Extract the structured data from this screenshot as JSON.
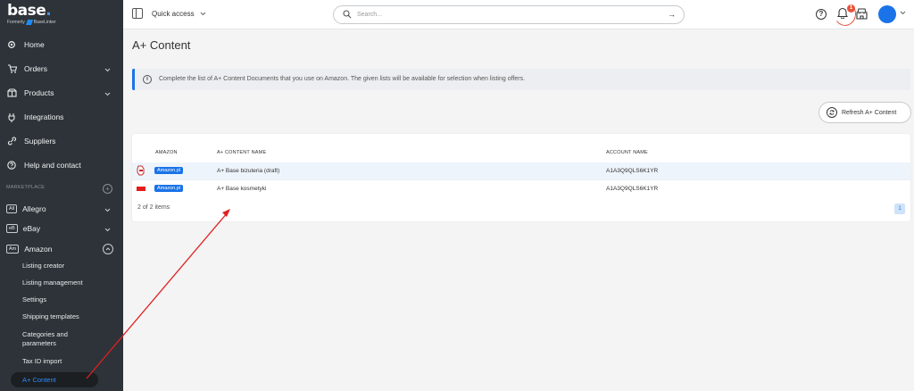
{
  "brand": {
    "name": "base",
    "formerly": "Formerly",
    "former_name": "BaseLinker"
  },
  "nav": {
    "items": [
      {
        "label": "Home",
        "icon": "gear-icon"
      },
      {
        "label": "Orders",
        "icon": "cart-icon"
      },
      {
        "label": "Products",
        "icon": "products-icon"
      },
      {
        "label": "Integrations",
        "icon": "plug-icon"
      },
      {
        "label": "Suppliers",
        "icon": "link-icon"
      },
      {
        "label": "Help and contact",
        "icon": "help-icon"
      }
    ],
    "section_label": "MARKETPLACE",
    "marketplaces": [
      {
        "badge": "All",
        "label": "Allegro"
      },
      {
        "badge": "eB",
        "label": "eBay"
      },
      {
        "badge": "Am",
        "label": "Amazon"
      }
    ],
    "amazon_subitems": [
      "Listing creator",
      "Listing management",
      "Settings",
      "Shipping templates",
      "Categories and parameters",
      "Tax ID import"
    ],
    "active_subitem": "A+ Content"
  },
  "header": {
    "quick_access": "Quick access",
    "search_placeholder": "Search...",
    "notification_count": "1"
  },
  "page": {
    "title": "A+ Content",
    "info_text": "Complete the list of A+ Content Documents that you use on Amazon. The given lists will be available for selection when listing offers.",
    "refresh_label": "Refresh A+ Content"
  },
  "table": {
    "headers": {
      "amazon": "AMAZON",
      "name": "A+ CONTENT NAME",
      "account": "ACCOUNT NAME"
    },
    "rows": [
      {
        "marketplace": "Amazon.pl",
        "name": "A+ Base bizuteria (draft)",
        "account": "A1A3Q9QLS6K1YR"
      },
      {
        "marketplace": "Amazon.pl",
        "name": "A+ Base kosmetyki",
        "account": "A1A3Q9QLS6K1YR"
      }
    ],
    "items_count": "2 of 2 items",
    "page": "1"
  },
  "colors": {
    "accent": "#1a73e8",
    "sidebar": "#2d3338",
    "annotation": "#e02020"
  }
}
